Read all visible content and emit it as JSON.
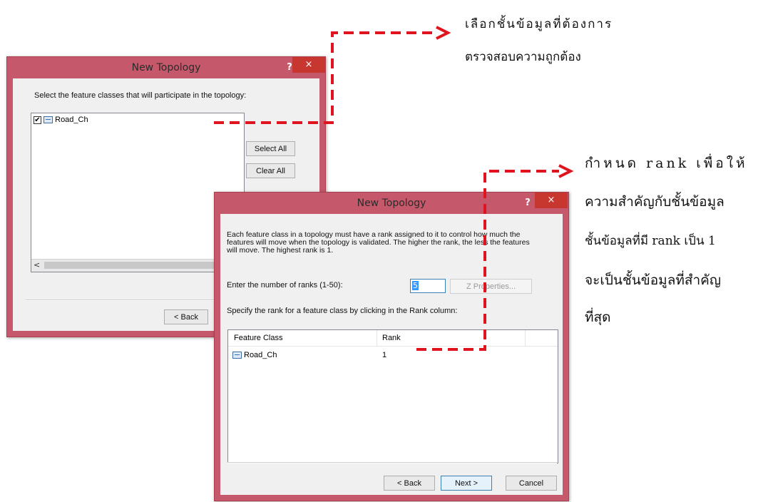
{
  "dialog1": {
    "title": "New Topology",
    "help": "?",
    "close": "×",
    "instruction": "Select the feature classes that will participate in the topology:",
    "items": [
      {
        "label": "Road_Ch",
        "checked": "✔"
      }
    ],
    "select_all": "Select All",
    "clear_all": "Clear All",
    "scroll_left": "<",
    "back": "< Back"
  },
  "dialog2": {
    "title": "New Topology",
    "help": "?",
    "close": "×",
    "description": "Each feature class in a topology must have a rank assigned to it to control how much the features will move when the topology is validated. The higher the rank, the less the features will move. The highest rank is 1.",
    "ranks_label": "Enter the number of ranks  (1-50):",
    "ranks_value": "5",
    "z_properties": "Z Properties...",
    "specify_label": "Specify the rank for a feature class by clicking in the Rank column:",
    "table": {
      "headers": [
        "Feature Class",
        "Rank"
      ],
      "rows": [
        {
          "feature_class": "Road_Ch",
          "rank": "1"
        }
      ]
    },
    "back": "< Back",
    "next": "Next >",
    "cancel": "Cancel"
  },
  "annotations": {
    "top_line1": "เลือกชั้นข้อมูลที่ต้องการ",
    "top_line2": "ตรวจสอบความถูกต้อง",
    "right_line1": "กำหนด rank เพื่อให้",
    "right_line2": "ความสำคัญกับชั้นข้อมูล",
    "right_line3": "ชั้นข้อมูลที่มี rank เป็น 1",
    "right_line4": "จะเป็นชั้นข้อมูลที่สำคัญ",
    "right_line5": "ที่สุด"
  },
  "colors": {
    "titlebar": "#c6586b",
    "close": "#c7372f",
    "arrow": "#e0141e"
  }
}
